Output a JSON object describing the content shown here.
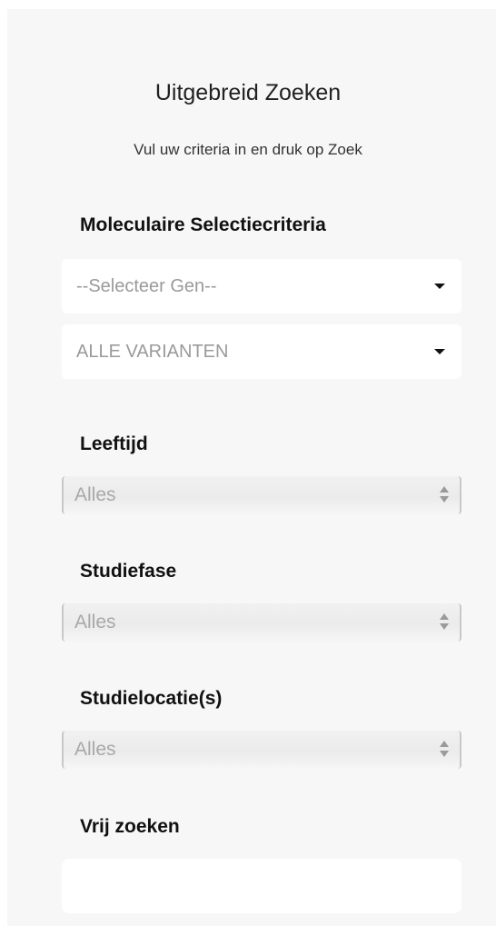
{
  "header": {
    "title": "Uitgebreid Zoeken",
    "subtitle": "Vul uw criteria in en druk op Zoek"
  },
  "molecular": {
    "label": "Moleculaire Selectiecriteria",
    "gene_select": "--Selecteer Gen--",
    "variant_select": "ALLE VARIANTEN"
  },
  "age": {
    "label": "Leeftijd",
    "value": "Alles"
  },
  "phase": {
    "label": "Studiefase",
    "value": "Alles"
  },
  "location": {
    "label": "Studielocatie(s)",
    "value": "Alles"
  },
  "free_search": {
    "label": "Vrij zoeken",
    "value": ""
  },
  "icons": {
    "dropdown_caret": "caret-down-icon",
    "select_stepper": "updown-stepper-icon"
  },
  "colors": {
    "panel_bg": "#f7f7f7",
    "placeholder_text": "#9a9a9a"
  }
}
